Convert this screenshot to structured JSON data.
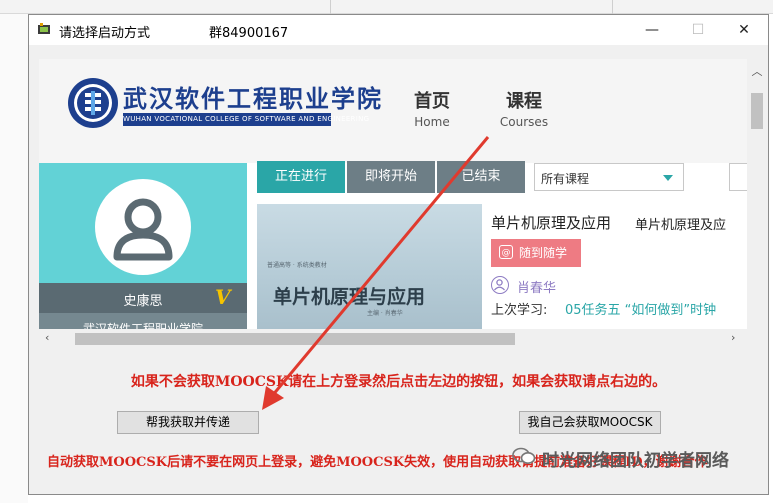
{
  "window": {
    "title": "请选择启动方式",
    "group": "群84900167",
    "minimize_label": "—",
    "maximize_label": "☐",
    "close_label": "✕"
  },
  "site": {
    "logo_cn": "武汉软件工程职业学院",
    "logo_en": "WUHAN VOCATIONAL COLLEGE OF SOFTWARE AND ENGINEERING",
    "nav": [
      {
        "cn": "首页",
        "en": "Home"
      },
      {
        "cn": "课程",
        "en": "Courses"
      }
    ]
  },
  "profile": {
    "name": "史康思",
    "vip_badge": "V",
    "school": "武汉软件工程职业学院"
  },
  "tabs": [
    {
      "label": "正在进行",
      "active": true
    },
    {
      "label": "即将开始",
      "active": false
    },
    {
      "label": "已结束",
      "active": false
    }
  ],
  "filter": {
    "selected": "所有课程"
  },
  "course": {
    "title": "单片机原理及应用",
    "title_repeat": "单片机原理及应",
    "cover_title": "单片机原理与应用",
    "cover_small": "普通高等 · 系统类教材",
    "cover_sub": "主编  · 肖春华",
    "action_label": "随到随学",
    "teacher": "肖春华",
    "last_study_label": "上次学习:",
    "last_study_value": "05任务五 “如何做到”时钟"
  },
  "instruction": "如果不会获取MOOCSK请在上方登录然后点击左边的按钮，如果会获取请点右边的。",
  "buttons": {
    "left": "帮我获取并传递",
    "right": "我自己会获取MOOCSK"
  },
  "notice": "自动获取MOOCSK后请不要在网页上登录，避免MOOCSK失效，使用自动获取请提前准备好课程ID，谢谢合作",
  "watermark": "时光网络团队初学者网络",
  "colors": {
    "teal": "#2aa6a7",
    "profile_bg": "#62d2d6",
    "tab_inactive": "#6d7e86",
    "alert_red": "#d8241c",
    "action_pink": "#ee7b83",
    "logo_blue": "#1d3f8e"
  }
}
